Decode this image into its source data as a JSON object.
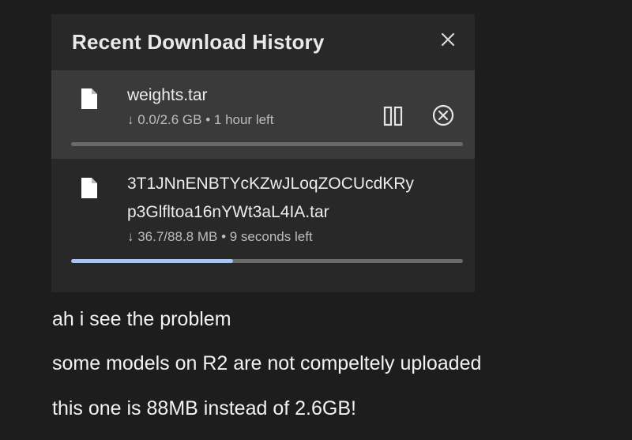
{
  "panel": {
    "title": "Recent Download History",
    "close_icon": "close-icon"
  },
  "downloads": [
    {
      "name_line1": "weights.tar",
      "name_line2": "",
      "progress_text": "↓ 0.0/2.6 GB • 1 hour left",
      "progress_fraction": 0.0,
      "state": "active-hover",
      "file_icon": "file-icon",
      "pause_icon": "pause-icon",
      "cancel_icon": "cancel-circle-icon"
    },
    {
      "name_line1": "3T1JNnENBTYcKZwJLoqZOCUcdKRy",
      "name_line2": "p3Glfltoa16nYWt3aL4IA.tar",
      "progress_text": "↓ 36.7/88.8 MB • 9 seconds left",
      "progress_fraction": 0.413,
      "state": "normal",
      "file_icon": "file-icon"
    }
  ],
  "chat_messages": [
    "ah i see the problem",
    "some models on R2 are not compeltely uploaded",
    "this one is 88MB instead of 2.6GB!"
  ],
  "colors": {
    "background": "#1d1d1e",
    "panel": "#282829",
    "active_row": "#3a3a3b",
    "progress_track": "#6a6a6b",
    "progress_fill": "#a8c4ec"
  }
}
